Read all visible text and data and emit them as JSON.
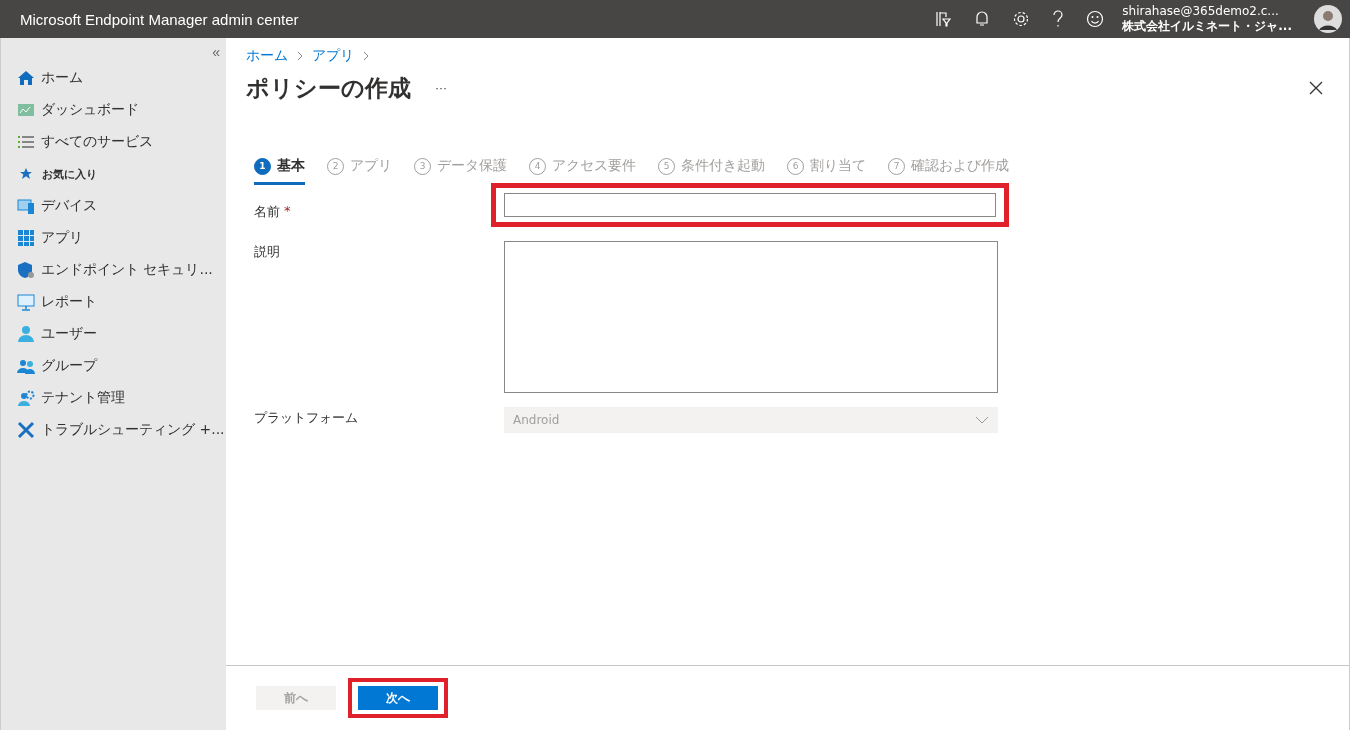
{
  "header": {
    "title": "Microsoft Endpoint Manager admin center",
    "user_email": "shirahase@365demo2.c...",
    "user_org": "株式会社イルミネート・ジャ..."
  },
  "sidebar": {
    "collapse": "«",
    "items": [
      {
        "kind": "item",
        "label": "ホーム"
      },
      {
        "kind": "item",
        "label": "ダッシュボード"
      },
      {
        "kind": "item",
        "label": "すべてのサービス"
      },
      {
        "kind": "section",
        "label": "お気に入り"
      },
      {
        "kind": "item",
        "label": "デバイス"
      },
      {
        "kind": "item",
        "label": "アプリ"
      },
      {
        "kind": "item",
        "label": "エンドポイント セキュリ..."
      },
      {
        "kind": "item",
        "label": "レポート"
      },
      {
        "kind": "item",
        "label": "ユーザー"
      },
      {
        "kind": "item",
        "label": "グループ"
      },
      {
        "kind": "item",
        "label": "テナント管理"
      },
      {
        "kind": "item",
        "label": "トラブルシューティング +..."
      }
    ]
  },
  "breadcrumb": [
    "ホーム",
    "アプリ"
  ],
  "page_title": "ポリシーの作成",
  "more": "···",
  "steps": [
    {
      "number": "1",
      "label": "基本",
      "selected": true
    },
    {
      "number": "2",
      "label": "アプリ",
      "selected": false
    },
    {
      "number": "3",
      "label": "データ保護",
      "selected": false
    },
    {
      "number": "4",
      "label": "アクセス要件",
      "selected": false
    },
    {
      "number": "5",
      "label": "条件付き起動",
      "selected": false
    },
    {
      "number": "6",
      "label": "割り当て",
      "selected": false
    },
    {
      "number": "7",
      "label": "確認および作成",
      "selected": false
    }
  ],
  "form": {
    "name": {
      "label": "名前",
      "required_mark": "*",
      "highlighted": true
    },
    "description": {
      "label": "説明"
    },
    "platform": {
      "label": "プラットフォーム",
      "value": "Android",
      "disabled": true
    }
  },
  "footer": {
    "previous": {
      "label": "前へ",
      "disabled": true,
      "highlighted": false
    },
    "next": {
      "label": "次へ",
      "disabled": false,
      "highlighted": true
    }
  }
}
